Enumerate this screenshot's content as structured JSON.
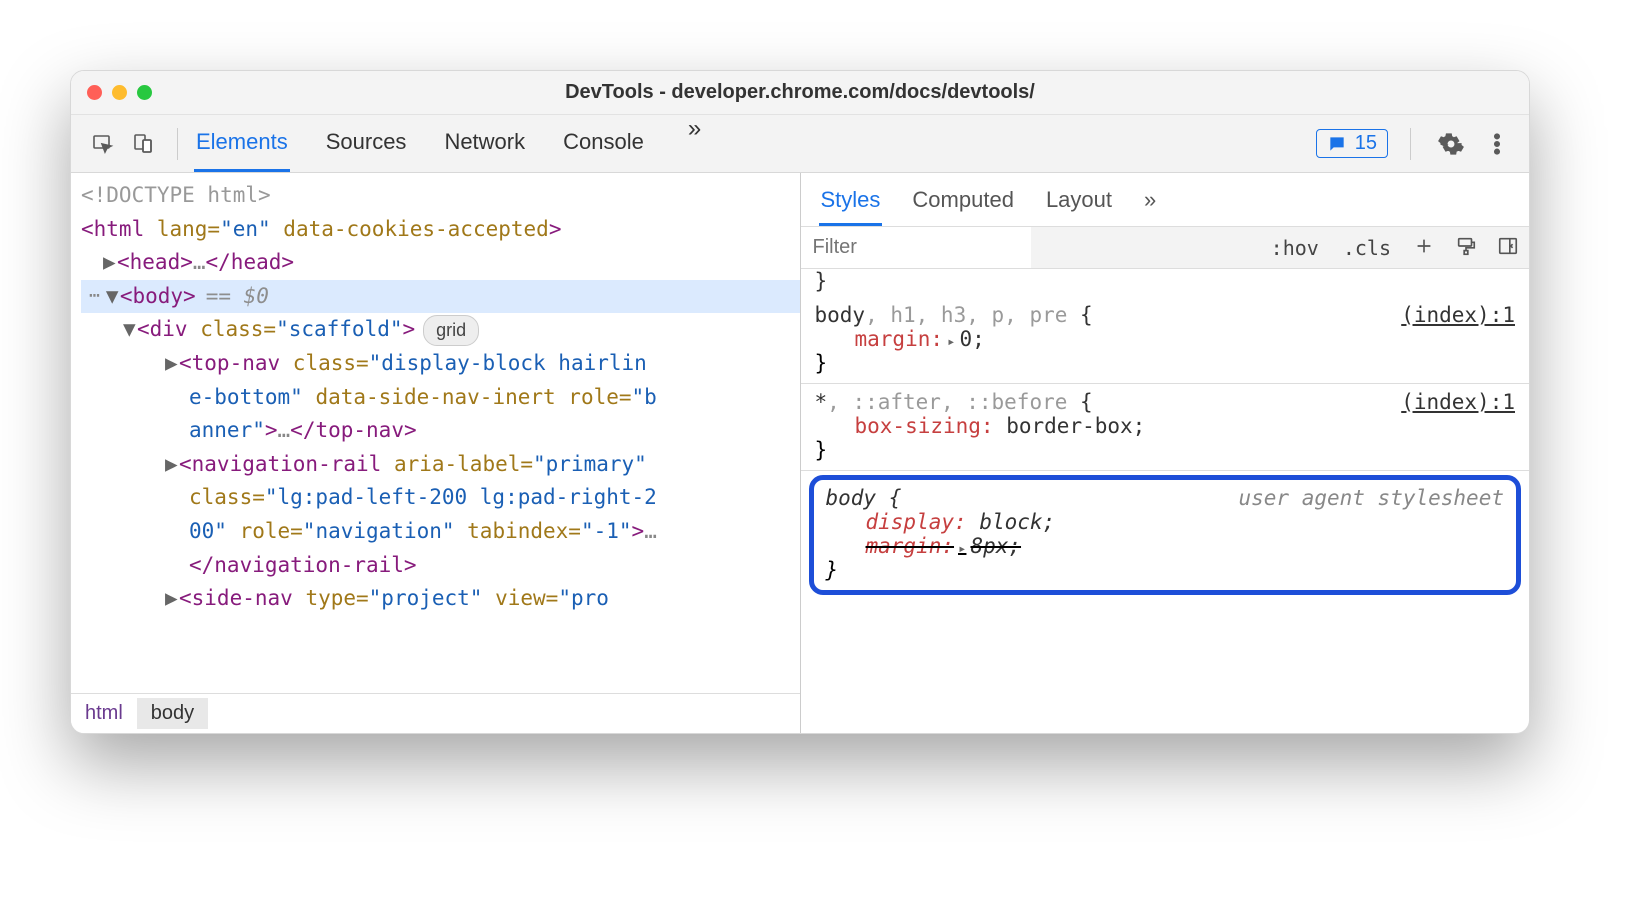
{
  "window": {
    "title": "DevTools - developer.chrome.com/docs/devtools/"
  },
  "toolbar": {
    "tabs": [
      "Elements",
      "Sources",
      "Network",
      "Console"
    ],
    "active_tab": "Elements",
    "badge_count": "15"
  },
  "dom": {
    "doctype": "<!DOCTYPE html>",
    "html_open": {
      "tag": "html",
      "attrs": "lang=\"en\" data-cookies-accepted"
    },
    "head": {
      "open": "head",
      "ellipsis": "…",
      "close": "head"
    },
    "body": {
      "open": "body",
      "eq": "== $0"
    },
    "scaffold": {
      "open": "div",
      "attrs": "class=\"scaffold\"",
      "pill": "grid"
    },
    "topnav_line1": "<top-nav class=\"display-block hairlin",
    "topnav_line2": "e-bottom\" data-side-nav-inert role=\"b",
    "topnav_line3_a": "anner\">",
    "topnav_line3_b": "…",
    "topnav_line3_c": "</top-nav>",
    "navrail_line1": "<navigation-rail aria-label=\"primary\"",
    "navrail_line2": "class=\"lg:pad-left-200 lg:pad-right-2",
    "navrail_line3": "00\" role=\"navigation\" tabindex=\"-1\">…",
    "navrail_line4": "</navigation-rail>",
    "sidenav_partial": "<side-nav type=\"project\" view=\"pro"
  },
  "breadcrumbs": [
    "html",
    "body"
  ],
  "styles": {
    "tabs": [
      "Styles",
      "Computed",
      "Layout"
    ],
    "active": "Styles",
    "filter_placeholder": "Filter",
    "hov": ":hov",
    "cls": ".cls",
    "rules": [
      {
        "selector_main": "body",
        "selector_rest": ", h1, h3, p, pre",
        "open": " {",
        "source": "(index):1",
        "props": [
          {
            "name": "margin:",
            "value": "0;"
          }
        ]
      },
      {
        "selector_main": "*",
        "selector_rest": ", ::after, ::before",
        "open": " {",
        "source": "(index):1",
        "props": [
          {
            "name": "box-sizing:",
            "value": "border-box;"
          }
        ]
      }
    ],
    "ua_rule": {
      "selector": "body {",
      "source": "user agent stylesheet",
      "props": [
        {
          "name": "display:",
          "value": "block;",
          "struck": false
        },
        {
          "name": "margin:",
          "value": "8px;",
          "struck": true
        }
      ],
      "close": "}"
    }
  }
}
